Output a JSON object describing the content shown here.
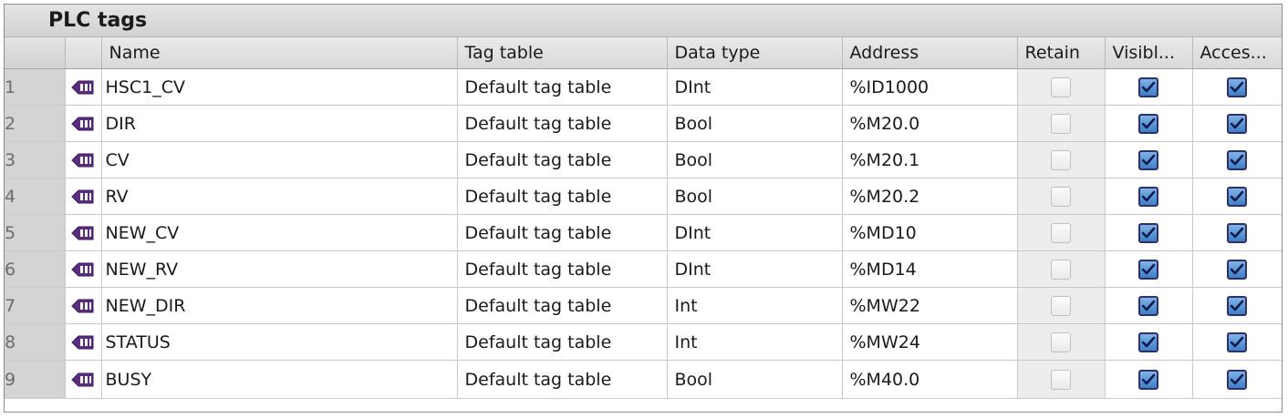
{
  "title": "PLC tags",
  "columns": {
    "num": "",
    "icon": "",
    "name": "Name",
    "tag_table": "Tag table",
    "data_type": "Data type",
    "address": "Address",
    "retain": "Retain",
    "visible": "Visibl...",
    "accessible": "Acces..."
  },
  "rows": [
    {
      "num": "1",
      "name": "HSC1_CV",
      "tag_table": "Default tag table",
      "data_type": "DInt",
      "address": "%ID1000",
      "retain": false,
      "visible": true,
      "accessible": true
    },
    {
      "num": "2",
      "name": "DIR",
      "tag_table": "Default tag table",
      "data_type": "Bool",
      "address": "%M20.0",
      "retain": false,
      "visible": true,
      "accessible": true
    },
    {
      "num": "3",
      "name": "CV",
      "tag_table": "Default tag table",
      "data_type": "Bool",
      "address": "%M20.1",
      "retain": false,
      "visible": true,
      "accessible": true
    },
    {
      "num": "4",
      "name": "RV",
      "tag_table": "Default tag table",
      "data_type": "Bool",
      "address": "%M20.2",
      "retain": false,
      "visible": true,
      "accessible": true
    },
    {
      "num": "5",
      "name": "NEW_CV",
      "tag_table": "Default tag table",
      "data_type": "DInt",
      "address": "%MD10",
      "retain": false,
      "visible": true,
      "accessible": true
    },
    {
      "num": "6",
      "name": "NEW_RV",
      "tag_table": "Default tag table",
      "data_type": "DInt",
      "address": "%MD14",
      "retain": false,
      "visible": true,
      "accessible": true
    },
    {
      "num": "7",
      "name": "NEW_DIR",
      "tag_table": "Default tag table",
      "data_type": "Int",
      "address": "%MW22",
      "retain": false,
      "visible": true,
      "accessible": true
    },
    {
      "num": "8",
      "name": "STATUS",
      "tag_table": "Default tag table",
      "data_type": "Int",
      "address": "%MW24",
      "retain": false,
      "visible": true,
      "accessible": true
    },
    {
      "num": "9",
      "name": "BUSY",
      "tag_table": "Default tag table",
      "data_type": "Bool",
      "address": "%M40.0",
      "retain": false,
      "visible": true,
      "accessible": true
    }
  ],
  "icons": {
    "tag": "plc-tag-icon",
    "checked": "checkbox-checked-icon",
    "unchecked": "checkbox-unchecked-icon"
  },
  "colors": {
    "header_bg": "#dcdcdc",
    "row_number_bg": "#d4d4d4",
    "tag_icon": "#5a2d82",
    "checkbox_checked": "#3f7fc7"
  }
}
